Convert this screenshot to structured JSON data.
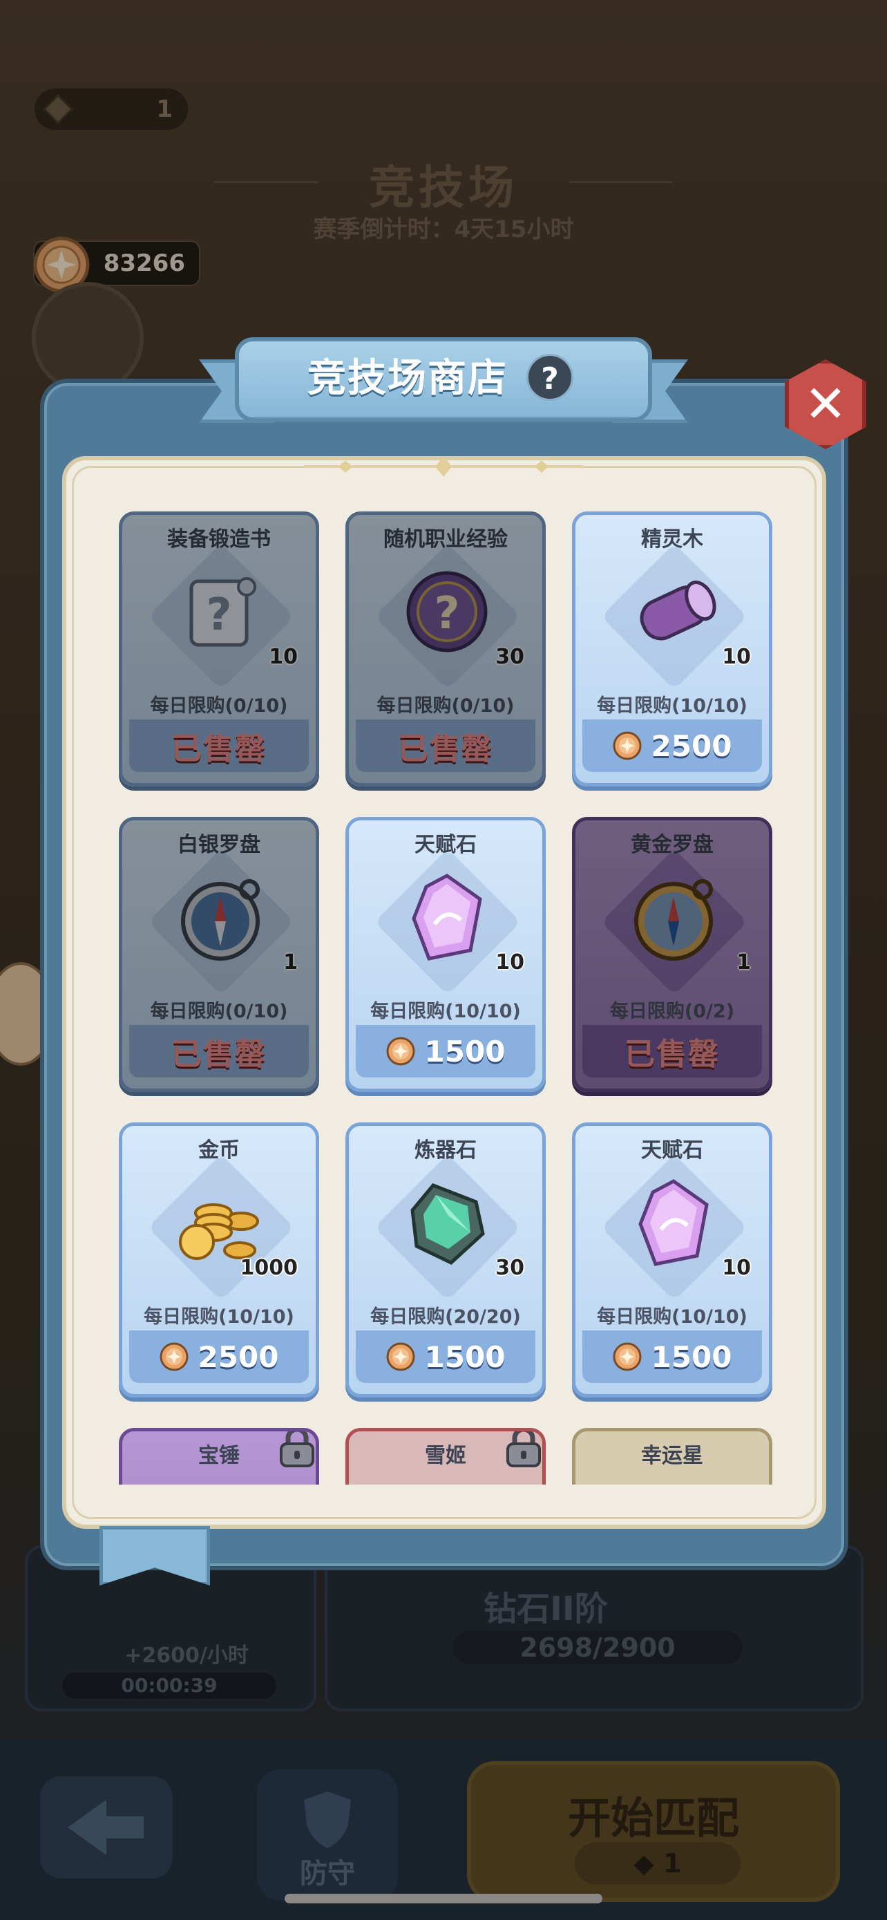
{
  "header": {
    "tickets": "1",
    "arena_title": "竞技场",
    "season_countdown": "赛季倒计时：4天15小时",
    "coins": "83266"
  },
  "shop": {
    "title": "竞技场商店",
    "help_symbol": "?",
    "close_symbol": "✕",
    "currency_icon": "arena-coin-icon",
    "items": [
      {
        "name": "装备锻造书",
        "icon": "scroll-icon",
        "qty": "10",
        "limit": "每日限购(0/10)",
        "sold_out": true,
        "sold_label": "已售罄",
        "rarity": "blue"
      },
      {
        "name": "随机职业经验",
        "icon": "mystery-orb-icon",
        "qty": "30",
        "limit": "每日限购(0/10)",
        "sold_out": true,
        "sold_label": "已售罄",
        "rarity": "blue"
      },
      {
        "name": "精灵木",
        "icon": "log-icon",
        "qty": "10",
        "limit": "每日限购(10/10)",
        "sold_out": false,
        "price": "2500",
        "rarity": "blue"
      },
      {
        "name": "白银罗盘",
        "icon": "silver-compass-icon",
        "qty": "1",
        "limit": "每日限购(0/10)",
        "sold_out": true,
        "sold_label": "已售罄",
        "rarity": "blue"
      },
      {
        "name": "天赋石",
        "icon": "talent-crystal-icon",
        "qty": "10",
        "limit": "每日限购(10/10)",
        "sold_out": false,
        "price": "1500",
        "rarity": "blue"
      },
      {
        "name": "黄金罗盘",
        "icon": "gold-compass-icon",
        "qty": "1",
        "limit": "每日限购(0/2)",
        "sold_out": true,
        "sold_label": "已售罄",
        "rarity": "purple"
      },
      {
        "name": "金币",
        "icon": "gold-coins-icon",
        "qty": "1000",
        "limit": "每日限购(10/10)",
        "sold_out": false,
        "price": "2500",
        "rarity": "blue"
      },
      {
        "name": "炼器石",
        "icon": "refine-stone-icon",
        "qty": "30",
        "limit": "每日限购(20/20)",
        "sold_out": false,
        "price": "1500",
        "rarity": "blue"
      },
      {
        "name": "天赋石",
        "icon": "talent-crystal-icon",
        "qty": "10",
        "limit": "每日限购(10/10)",
        "sold_out": false,
        "price": "1500",
        "rarity": "blue"
      },
      {
        "name": "宝锤",
        "icon": "lock-icon",
        "locked": true,
        "rarity": "purple"
      },
      {
        "name": "雪姬",
        "icon": "lock-icon",
        "locked": true,
        "rarity": "red"
      },
      {
        "name": "幸运星",
        "icon": "",
        "locked": false,
        "rarity": "tan"
      }
    ]
  },
  "background": {
    "income": "+2600/小时",
    "timer": "00:00:39",
    "rank_name": "钻石II阶",
    "rank_progress": "2698/2900",
    "defend_label": "防守",
    "match_label": "开始匹配",
    "match_cost": "1"
  },
  "colors": {
    "frame": "#4f7a98",
    "card_blue": "#b8d4f0",
    "card_purple": "#9a78be",
    "sold_text": "#ff8c8c",
    "close_red": "#c8504a"
  }
}
